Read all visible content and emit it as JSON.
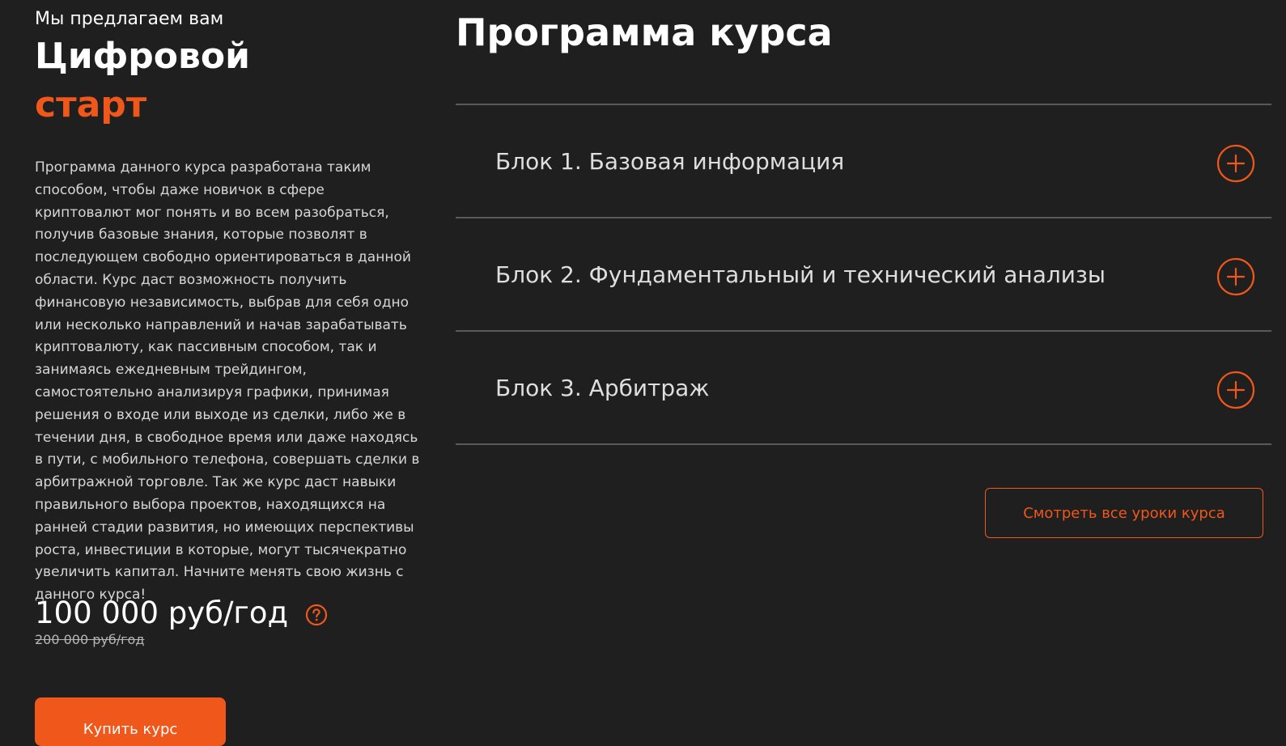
{
  "offer": {
    "eyebrow": "Мы предлагаем вам",
    "title_line1": "Цифровой",
    "title_line2": "старт",
    "description": "Программа данного курса разработана таким способом, чтобы даже новичок в сфере криптовалют мог понять и во всем разобраться, получив базовые знания, которые позволят в последующем свободно ориентироваться в данной области. Курс даст возможность получить финансовую независимость, выбрав для себя одно или несколько направлений и начав зарабатывать криптовалюту, как пассивным способом, так и занимаясь ежедневным трейдингом, самостоятельно анализируя графики, принимая решения о входе или выходе из сделки, либо же в течении дня, в свободное время или даже находясь в пути, с мобильного телефона, совершать сделки в арбитражной торговле. Так же курс даст навыки правильного выбора проектов, находящихся на ранней стадии развития, но имеющих перспективы роста, инвестиции в которые, могут тысячекратно увеличить капитал. Начните менять свою жизнь с данного курса!",
    "price": "100 000 руб/год",
    "old_price": "200 000 руб/год",
    "help_icon": "question-circle-icon",
    "buy_label": "Купить курс"
  },
  "program": {
    "title": "Программа курса",
    "blocks": [
      {
        "label": "Блок 1. Базовая информация",
        "icon": "plus-circle-icon"
      },
      {
        "label": "Блок 2. Фундаментальный и технический анализы",
        "icon": "plus-circle-icon"
      },
      {
        "label": "Блок 3. Арбитраж",
        "icon": "plus-circle-icon"
      }
    ],
    "all_lessons_label": "Смотреть все уроки курса"
  },
  "colors": {
    "background": "#1f1f1f",
    "accent": "#f0571a",
    "divider": "#5a5a5a",
    "text": "#ffffff",
    "muted_text": "#d6d6d6"
  }
}
